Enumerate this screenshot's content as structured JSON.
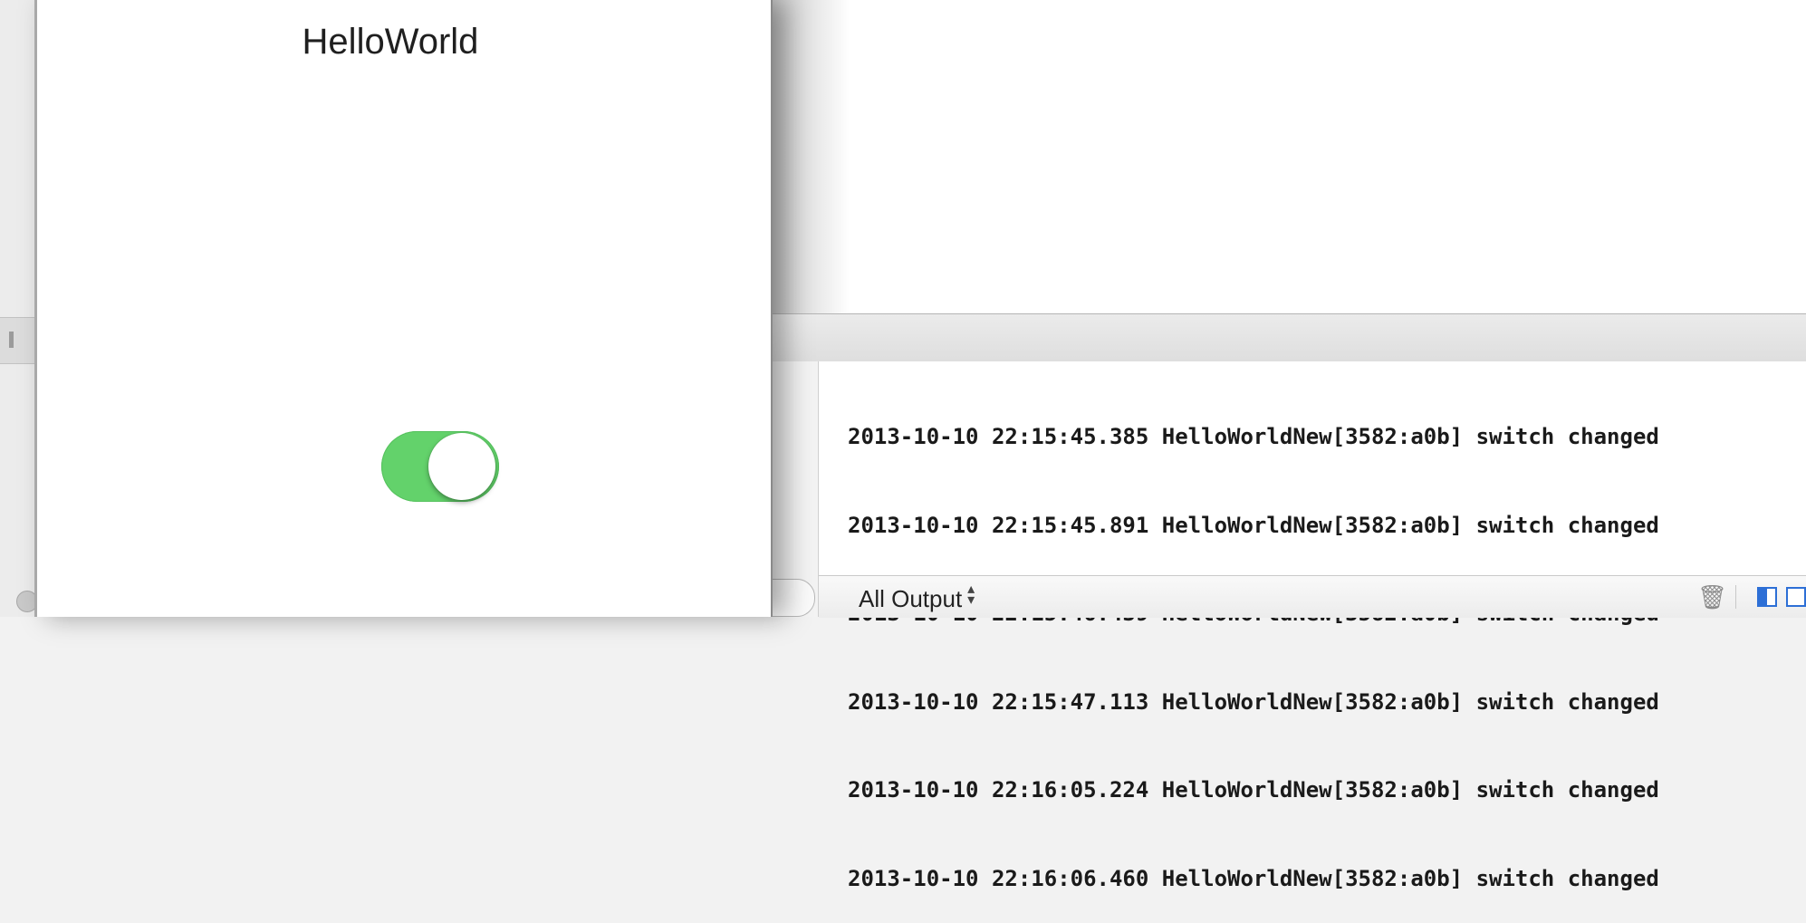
{
  "simulator": {
    "title": "HelloWorld",
    "switch_on": true,
    "switch_color": "#63d26b"
  },
  "console": {
    "lines": [
      "2013-10-10 22:15:45.385 HelloWorldNew[3582:a0b] switch changed",
      "2013-10-10 22:15:45.891 HelloWorldNew[3582:a0b] switch changed",
      "2013-10-10 22:15:46.439 HelloWorldNew[3582:a0b] switch changed",
      "2013-10-10 22:15:47.113 HelloWorldNew[3582:a0b] switch changed",
      "2013-10-10 22:16:05.224 HelloWorldNew[3582:a0b] switch changed",
      "2013-10-10 22:16:06.460 HelloWorldNew[3582:a0b] switch changed"
    ],
    "footer": {
      "output_filter": "All Output",
      "trash_icon": "trash-icon",
      "split_icons": [
        "left-panel-icon",
        "right-panel-icon"
      ]
    }
  }
}
